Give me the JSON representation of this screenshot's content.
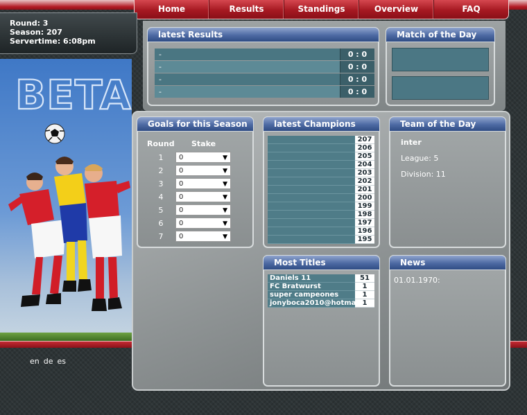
{
  "nav": {
    "home": "Home",
    "results": "Results",
    "standings": "Standings",
    "overview": "Overview",
    "faq": "FAQ"
  },
  "info": {
    "round": "Round: 3",
    "season": "Season: 207",
    "servertime": "Servertime: 6:08pm"
  },
  "beta_logo_text": "BETA",
  "latest_results": {
    "title": "latest Results",
    "rows": [
      {
        "team": "-",
        "score": "0 : 0"
      },
      {
        "team": "-",
        "score": "0 : 0"
      },
      {
        "team": "-",
        "score": "0 : 0"
      },
      {
        "team": "-",
        "score": "0 : 0"
      }
    ]
  },
  "match_of_the_day": {
    "title": "Match of the Day"
  },
  "goals": {
    "title": "Goals for this Season",
    "col_round": "Round",
    "col_stake": "Stake",
    "rows": [
      {
        "round": "1",
        "stake": "0"
      },
      {
        "round": "2",
        "stake": "0"
      },
      {
        "round": "3",
        "stake": "0"
      },
      {
        "round": "4",
        "stake": "0"
      },
      {
        "round": "5",
        "stake": "0"
      },
      {
        "round": "6",
        "stake": "0"
      },
      {
        "round": "7",
        "stake": "0"
      }
    ]
  },
  "latest_champions": {
    "title": "latest Champions",
    "seasons": [
      "207",
      "206",
      "205",
      "204",
      "203",
      "202",
      "201",
      "200",
      "199",
      "198",
      "197",
      "196",
      "195"
    ]
  },
  "team_of_the_day": {
    "title": "Team of the Day",
    "team": "inter",
    "league": "League: 5",
    "division": "Division: 11"
  },
  "most_titles": {
    "title": "Most Titles",
    "rows": [
      {
        "name": "Daniels 11",
        "count": "51"
      },
      {
        "name": "FC Bratwurst",
        "count": "1"
      },
      {
        "name": "super campeones",
        "count": "1"
      },
      {
        "name": "jonyboca2010@hotma",
        "count": "1"
      }
    ]
  },
  "news": {
    "title": "News",
    "date": "01.01.1970:"
  },
  "langs": [
    "en",
    "de",
    "es"
  ],
  "icons": {
    "dropdown": "caret-down-icon",
    "ball": "soccer-ball-icon"
  }
}
